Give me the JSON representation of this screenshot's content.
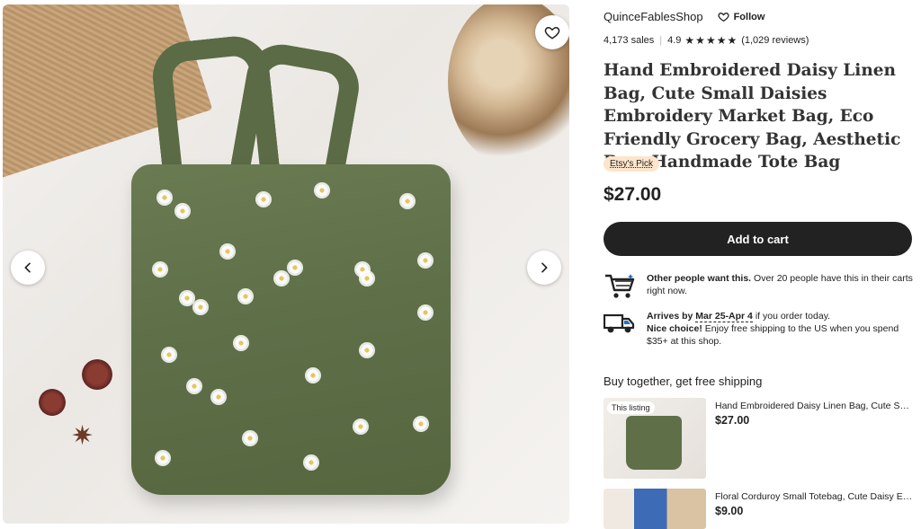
{
  "gallery": {
    "image_alt": "Green embroidered daisy linen tote bag"
  },
  "shop": {
    "name": "QuinceFablesShop",
    "follow_label": "Follow",
    "sales": "4,173 sales",
    "rating": "4.9",
    "stars": "★★★★★",
    "reviews": "(1,029 reviews)"
  },
  "listing": {
    "title": "Hand Embroidered Daisy Linen Bag, Cute Small Daisies Embroidery Market Bag, Eco Friendly Grocery Bag, Aesthetic Bag, Handmade Tote Bag",
    "badge": "Etsy's Pick",
    "price": "$27.00",
    "add_to_cart": "Add to cart"
  },
  "features": {
    "demand_bold": "Other people want this.",
    "demand_text": " Over 20 people have this in their carts right now.",
    "arrives_label": "Arrives by",
    "arrives_date": "Mar 25-Apr 4",
    "arrives_rest": " if you order today.",
    "shipping_bold": "Nice choice!",
    "shipping_text": " Enjoy free shipping to the US when you spend $35+ at this shop."
  },
  "buy_together": {
    "title": "Buy together, get free shipping",
    "items": [
      {
        "tag": "This listing",
        "name": "Hand Embroidered Daisy Linen Bag, Cute Small Daisies Embroidery Market Bag",
        "price": "$27.00"
      },
      {
        "tag": "",
        "name": "Floral Corduroy Small Totebag, Cute Daisy Embroidered Bag",
        "price": "$9.00"
      }
    ]
  },
  "colors": {
    "accent": "#222222",
    "badge_bg": "#fde5cc",
    "bag_green": "#5f7049"
  },
  "icons": {
    "favorite": "heart-icon",
    "prev": "chevron-left-icon",
    "next": "chevron-right-icon",
    "cart": "shopping-cart-icon",
    "truck": "delivery-truck-icon"
  }
}
